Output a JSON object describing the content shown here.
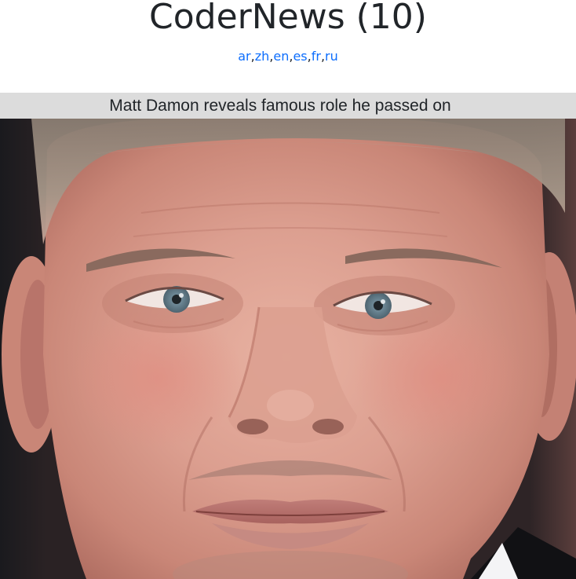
{
  "header": {
    "title": "CoderNews (10)",
    "languages": [
      {
        "code": "ar"
      },
      {
        "code": "zh"
      },
      {
        "code": "en"
      },
      {
        "code": "es"
      },
      {
        "code": "fr"
      },
      {
        "code": "ru"
      }
    ],
    "separator": ","
  },
  "article": {
    "headline": "Matt Damon reveals famous role he passed on",
    "image_subject": "close-up portrait photo of Matt Damon"
  },
  "colors": {
    "link": "#0d6efd",
    "text": "#212529",
    "headline_bar": "#dcdcdc"
  }
}
